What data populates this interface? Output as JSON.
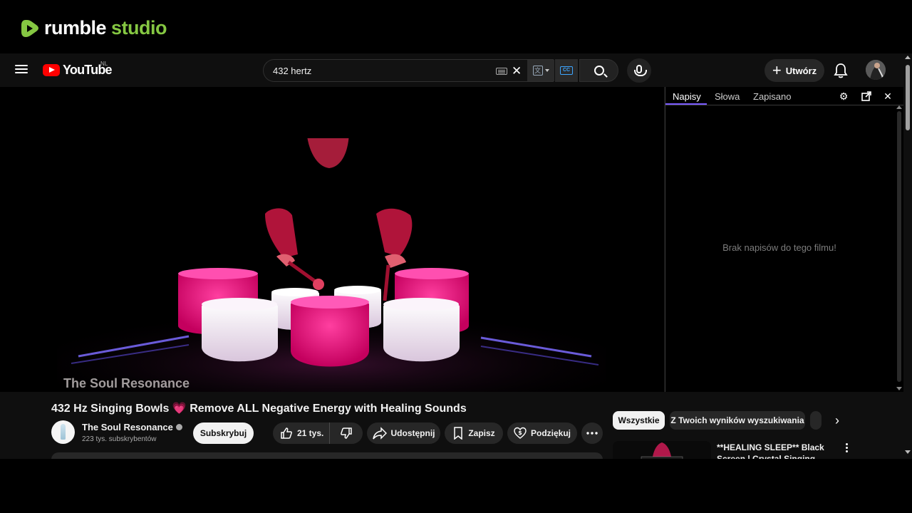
{
  "rumble": {
    "brand_part1": "rumble",
    "brand_part2": "studio",
    "accent": "#85c742"
  },
  "header": {
    "logo_text": "YouTube",
    "region": "NL",
    "search_value": "432 hertz",
    "create_label": "Utwórz"
  },
  "video": {
    "watermark": "The Soul Resonance",
    "title": "432 Hz Singing Bowls",
    "title_emoji": "💗",
    "title_rest": "Remove ALL Negative Energy with Healing Sounds"
  },
  "transcript_panel": {
    "tabs": [
      "Napisy",
      "Słowa",
      "Zapisano"
    ],
    "empty_message": "Brak napisów do tego filmu!"
  },
  "channel": {
    "name": "The Soul Resonance",
    "subscribers": "223 tys. subskrybentów",
    "subscribe_label": "Subskrybuj"
  },
  "actions": {
    "likes": "21 tys.",
    "share": "Udostępnij",
    "save": "Zapisz",
    "thanks": "Podziękuj"
  },
  "chips": [
    "Wszystkie",
    "Z Twoich wyników wyszukiwania"
  ],
  "recommendation": {
    "title": "**HEALING SLEEP** Black Screen | Crystal Singing Bowls"
  },
  "icons": [
    "rumble-play-icon",
    "menu-icon",
    "youtube-play-icon",
    "keyboard-icon",
    "close-icon",
    "translate-icon",
    "cc-search-icon",
    "search-icon",
    "mic-icon",
    "plus-icon",
    "bell-icon",
    "gear-icon",
    "popout-icon",
    "verified-icon",
    "thumbs-up-icon",
    "thumbs-down-icon",
    "share-icon",
    "bookmark-icon",
    "thanks-icon",
    "more-icon",
    "chevron-right-icon"
  ]
}
